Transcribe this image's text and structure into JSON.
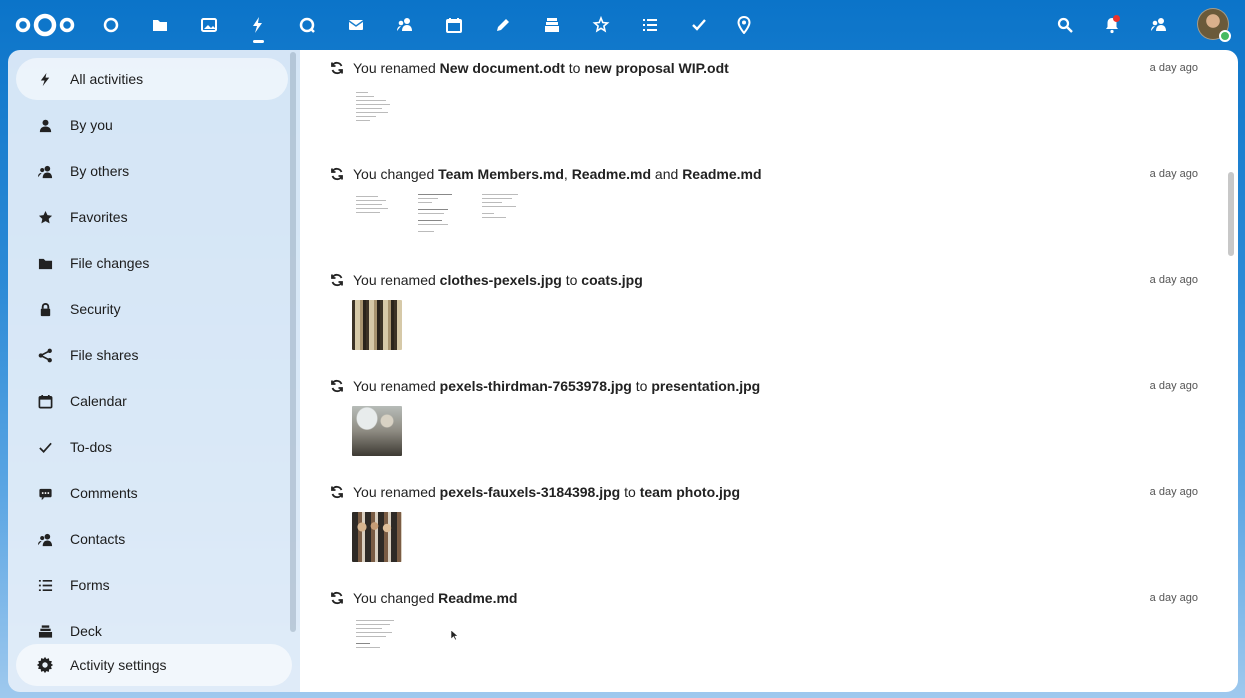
{
  "topbar": {
    "apps": [
      {
        "icon": "dashboard-icon"
      },
      {
        "icon": "files-icon"
      },
      {
        "icon": "photos-icon"
      },
      {
        "icon": "activity-icon",
        "active": true
      },
      {
        "icon": "talk-icon"
      },
      {
        "icon": "mail-icon"
      },
      {
        "icon": "contacts-icon"
      },
      {
        "icon": "calendar-icon"
      },
      {
        "icon": "notes-icon"
      },
      {
        "icon": "deck-icon"
      },
      {
        "icon": "magic-icon"
      },
      {
        "icon": "forms-icon"
      },
      {
        "icon": "tasks-icon"
      },
      {
        "icon": "maps-icon"
      }
    ],
    "right_icons": [
      "search-icon",
      "notifications-icon",
      "contacts-menu-icon"
    ],
    "accent": "#0082c9"
  },
  "sidebar": {
    "items": [
      {
        "label": "All activities",
        "icon": "lightning-icon",
        "active": true
      },
      {
        "label": "By you",
        "icon": "user-icon"
      },
      {
        "label": "By others",
        "icon": "users-icon"
      },
      {
        "label": "Favorites",
        "icon": "star-icon"
      },
      {
        "label": "File changes",
        "icon": "folder-icon"
      },
      {
        "label": "Security",
        "icon": "lock-icon"
      },
      {
        "label": "File shares",
        "icon": "share-icon"
      },
      {
        "label": "Calendar",
        "icon": "calendar-icon"
      },
      {
        "label": "To-dos",
        "icon": "checkmark-icon"
      },
      {
        "label": "Comments",
        "icon": "comment-icon"
      },
      {
        "label": "Contacts",
        "icon": "contacts-icon"
      },
      {
        "label": "Forms",
        "icon": "list-icon"
      },
      {
        "label": "Deck",
        "icon": "deck-icon"
      }
    ],
    "settings_label": "Activity settings"
  },
  "activities": [
    {
      "parts": [
        {
          "t": "You renamed "
        },
        {
          "t": "New document.odt",
          "b": true
        },
        {
          "t": " to "
        },
        {
          "t": "new proposal WIP.odt",
          "b": true
        }
      ],
      "time": "a day ago"
    },
    {
      "parts": [
        {
          "t": "You changed "
        },
        {
          "t": "Team Members.md",
          "b": true
        },
        {
          "t": ", "
        },
        {
          "t": "Readme.md",
          "b": true
        },
        {
          "t": " and "
        },
        {
          "t": "Readme.md",
          "b": true
        }
      ],
      "time": "a day ago"
    },
    {
      "parts": [
        {
          "t": "You renamed "
        },
        {
          "t": "clothes-pexels.jpg",
          "b": true
        },
        {
          "t": " to "
        },
        {
          "t": "coats.jpg",
          "b": true
        }
      ],
      "time": "a day ago"
    },
    {
      "parts": [
        {
          "t": "You renamed "
        },
        {
          "t": "pexels-thirdman-7653978.jpg",
          "b": true
        },
        {
          "t": " to "
        },
        {
          "t": "presentation.jpg",
          "b": true
        }
      ],
      "time": "a day ago"
    },
    {
      "parts": [
        {
          "t": "You renamed "
        },
        {
          "t": "pexels-fauxels-3184398.jpg",
          "b": true
        },
        {
          "t": " to "
        },
        {
          "t": "team photo.jpg",
          "b": true
        }
      ],
      "time": "a day ago"
    },
    {
      "parts": [
        {
          "t": "You changed "
        },
        {
          "t": "Readme.md",
          "b": true
        }
      ],
      "time": "a day ago"
    }
  ]
}
